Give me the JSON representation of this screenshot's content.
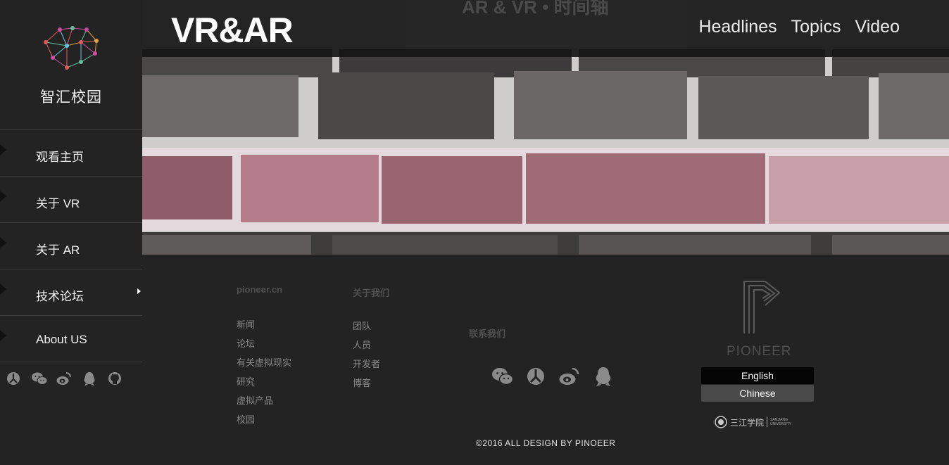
{
  "sidebar": {
    "brand": "智汇校园",
    "nav": [
      {
        "label": "观看主页",
        "has_sub": false
      },
      {
        "label": "关于  VR",
        "has_sub": false
      },
      {
        "label": "关于  AR",
        "has_sub": false
      },
      {
        "label": "技术论坛",
        "has_sub": true
      },
      {
        "label": "About US",
        "has_sub": false
      }
    ],
    "social_icons": [
      "renren-icon",
      "wechat-icon",
      "weibo-icon",
      "qq-icon",
      "github-icon"
    ]
  },
  "header": {
    "title": "VR&AR",
    "ghost_text": "AR & VR • 时间轴",
    "nav": [
      "Headlines",
      "Topics",
      "Video"
    ]
  },
  "footer": {
    "col1": {
      "head": "pioneer.cn",
      "links": [
        "新闻",
        "论坛",
        "有关虚拟现实",
        "研究",
        "虚拟产品",
        "校园"
      ]
    },
    "col2": {
      "head": "关于我们",
      "links": [
        "团队",
        "人员",
        "开发者",
        "博客"
      ]
    },
    "col3": {
      "head": "联系我们",
      "icons": [
        "wechat-icon",
        "renren-icon",
        "weibo-icon",
        "qq-icon"
      ]
    },
    "brand": {
      "name": "PIONEER",
      "lang_en": "English",
      "lang_cn": "Chinese",
      "university": "三江学院",
      "university_en_1": "SANJIANG",
      "university_en_2": "UNIVERSITY"
    },
    "copyright": "©2016  ALL  DESIGN  BY  PINOEER"
  },
  "colors": {
    "background": "#232323",
    "brick_gray": "#6e6a69",
    "brick_red": "#9a6470"
  }
}
